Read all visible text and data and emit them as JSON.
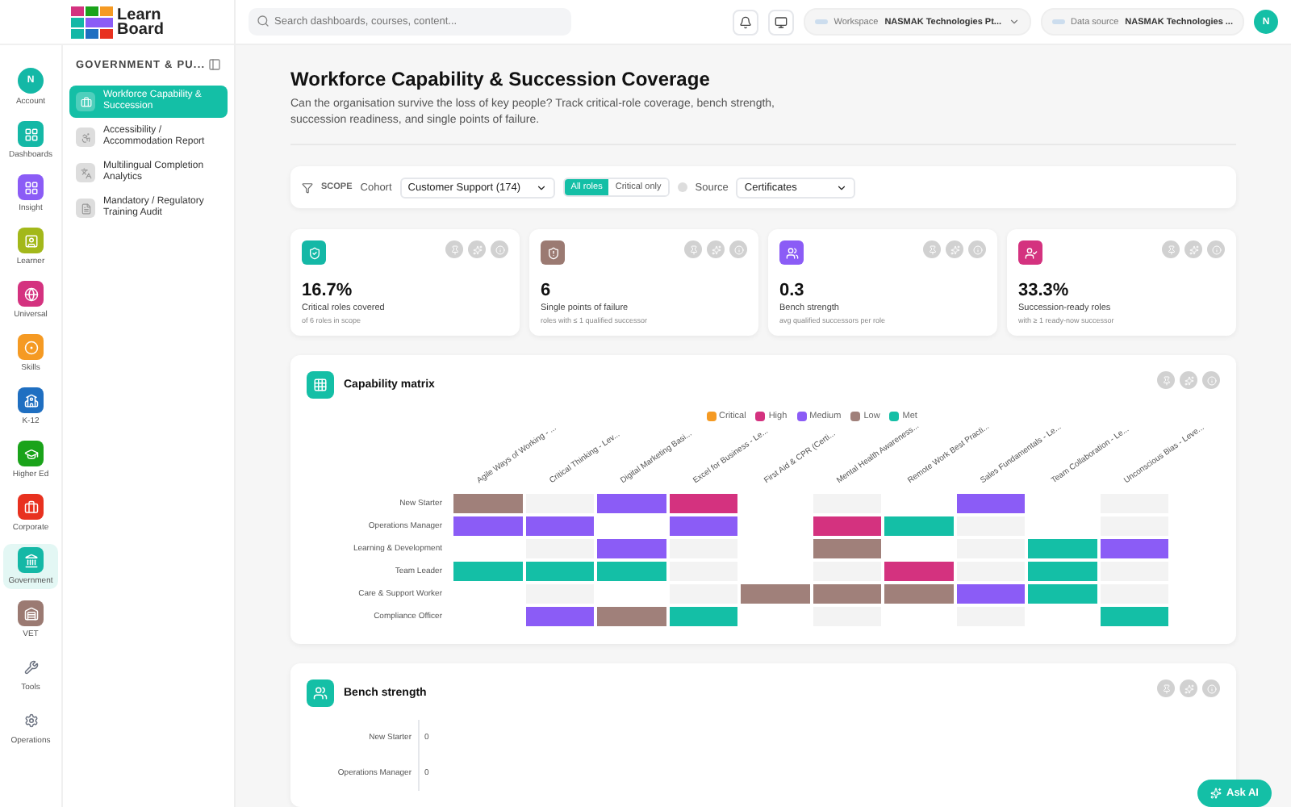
{
  "logo": {
    "lines": [
      "Learn",
      "Board"
    ]
  },
  "rail": [
    {
      "label": "Account",
      "kind": "avatar",
      "initial": "N",
      "color": "#14b8a6",
      "selected": false
    },
    {
      "label": "Dashboards",
      "kind": "badge",
      "color": "#14b8a6",
      "selected": false
    },
    {
      "label": "Insight",
      "kind": "badge",
      "color": "#8b5cf6",
      "selected": false
    },
    {
      "label": "Learner",
      "kind": "badge",
      "color": "#a3b81a",
      "selected": false
    },
    {
      "label": "Universal",
      "kind": "badge",
      "color": "#d4327f",
      "selected": false
    },
    {
      "label": "Skills",
      "kind": "badge",
      "color": "#f59a23",
      "selected": false
    },
    {
      "label": "K-12",
      "kind": "badge",
      "color": "#1f6fc1",
      "selected": false
    },
    {
      "label": "Higher Ed",
      "kind": "badge",
      "color": "#1aa31a",
      "selected": false
    },
    {
      "label": "Corporate",
      "kind": "badge",
      "color": "#e8311f",
      "selected": false
    },
    {
      "label": "Government",
      "kind": "badge",
      "color": "#14b8a6",
      "selected": true
    },
    {
      "label": "VET",
      "kind": "badge",
      "color": "#9b7a72",
      "selected": false
    },
    {
      "label": "Tools",
      "kind": "plain",
      "color": "#6b7280",
      "selected": false
    },
    {
      "label": "Operations",
      "kind": "plain",
      "color": "#6b7280",
      "selected": false
    }
  ],
  "panel": {
    "title": "GOVERNMENT & PU...",
    "items": [
      {
        "label": "Workforce Capability & Succession",
        "selected": true
      },
      {
        "label": "Accessibility / Accommodation Report",
        "selected": false
      },
      {
        "label": "Multilingual Completion Analytics",
        "selected": false
      },
      {
        "label": "Mandatory / Regulatory Training Audit",
        "selected": false
      }
    ]
  },
  "topbar": {
    "search": {
      "placeholder": "Search dashboards, courses, content..."
    },
    "workspace": {
      "label": "Workspace",
      "value": "NASMAK Technologies Pt..."
    },
    "data_source": {
      "label": "Data source",
      "value": "NASMAK Technologies ..."
    },
    "avatar": "N"
  },
  "page": {
    "title": "Workforce Capability & Succession Coverage",
    "subtitle": "Can the organisation survive the loss of key people? Track critical-role coverage, bench strength, succession readiness, and single points of failure."
  },
  "filters": {
    "scope": "SCOPE",
    "cohort_label": "Cohort",
    "cohort": "Customer Support (174)",
    "segments": [
      {
        "label": "All roles",
        "selected": true
      },
      {
        "label": "Critical only",
        "selected": false
      }
    ],
    "source_label": "Source",
    "source": "Certificates"
  },
  "kpis": [
    {
      "value": "16.7%",
      "label": "Critical roles covered",
      "note": "of 6 roles in scope",
      "color": "#14b8a6"
    },
    {
      "value": "6",
      "label": "Single points of failure",
      "note": "roles with ≤ 1 qualified successor",
      "color": "#9b7a72"
    },
    {
      "value": "0.3",
      "label": "Bench strength",
      "note": "avg qualified successors per role",
      "color": "#8b5cf6"
    },
    {
      "value": "33.3%",
      "label": "Succession-ready roles",
      "note": "with ≥ 1 ready-now successor",
      "color": "#d4327f"
    }
  ],
  "capability_matrix": {
    "title": "Capability matrix",
    "legend": [
      {
        "label": "Critical",
        "color": "#f59a23"
      },
      {
        "label": "High",
        "color": "#d4327f"
      },
      {
        "label": "Medium",
        "color": "#8b5cf6"
      },
      {
        "label": "Low",
        "color": "#a0807a"
      },
      {
        "label": "Met",
        "color": "#14bfa6"
      }
    ],
    "columns": [
      "Agile Ways of Working - ...",
      "Critical Thinking - Lev...",
      "Digital Marketing Basi...",
      "Excel for Business - Le...",
      "First Aid & CPR (Certi...",
      "Mental Health Awareness...",
      "Remote Work Best Practi...",
      "Sales Fundamentals - Le...",
      "Team Collaboration - Le...",
      "Unconscious Bias - Leve..."
    ],
    "rows": [
      {
        "label": "New Starter",
        "cells": [
          {
            "color": "#a0807a"
          },
          null,
          {
            "color": "#8b5cf6"
          },
          {
            "color": "#d4327f"
          },
          null,
          null,
          null,
          {
            "color": "#8b5cf6"
          },
          null,
          null
        ]
      },
      {
        "label": "Operations Manager",
        "cells": [
          {
            "color": "#8b5cf6"
          },
          {
            "color": "#8b5cf6"
          },
          null,
          {
            "color": "#8b5cf6"
          },
          null,
          {
            "color": "#d4327f"
          },
          {
            "color": "#14bfa6"
          },
          null,
          null,
          null
        ]
      },
      {
        "label": "Learning & Development",
        "cells": [
          null,
          null,
          {
            "color": "#8b5cf6"
          },
          null,
          null,
          {
            "color": "#a0807a"
          },
          null,
          null,
          {
            "color": "#14bfa6"
          },
          {
            "color": "#8b5cf6"
          }
        ]
      },
      {
        "label": "Team Leader",
        "cells": [
          {
            "color": "#14bfa6"
          },
          {
            "color": "#14bfa6"
          },
          {
            "color": "#14bfa6"
          },
          null,
          null,
          null,
          {
            "color": "#d4327f"
          },
          null,
          {
            "color": "#14bfa6"
          },
          null
        ]
      },
      {
        "label": "Care & Support Worker",
        "cells": [
          null,
          null,
          null,
          null,
          {
            "color": "#a0807a"
          },
          {
            "color": "#a0807a"
          },
          {
            "color": "#a0807a"
          },
          {
            "color": "#8b5cf6"
          },
          {
            "color": "#14bfa6"
          },
          null
        ]
      },
      {
        "label": "Compliance Officer",
        "cells": [
          null,
          {
            "color": "#8b5cf6"
          },
          {
            "color": "#a0807a"
          },
          {
            "color": "#14bfa6"
          },
          null,
          null,
          null,
          null,
          null,
          {
            "color": "#14bfa6"
          }
        ]
      }
    ]
  },
  "bench": {
    "title": "Bench strength",
    "rows": [
      {
        "label": "New Starter",
        "value": "0"
      },
      {
        "label": "Operations Manager",
        "value": "0"
      }
    ]
  },
  "ask_ai": "Ask AI"
}
